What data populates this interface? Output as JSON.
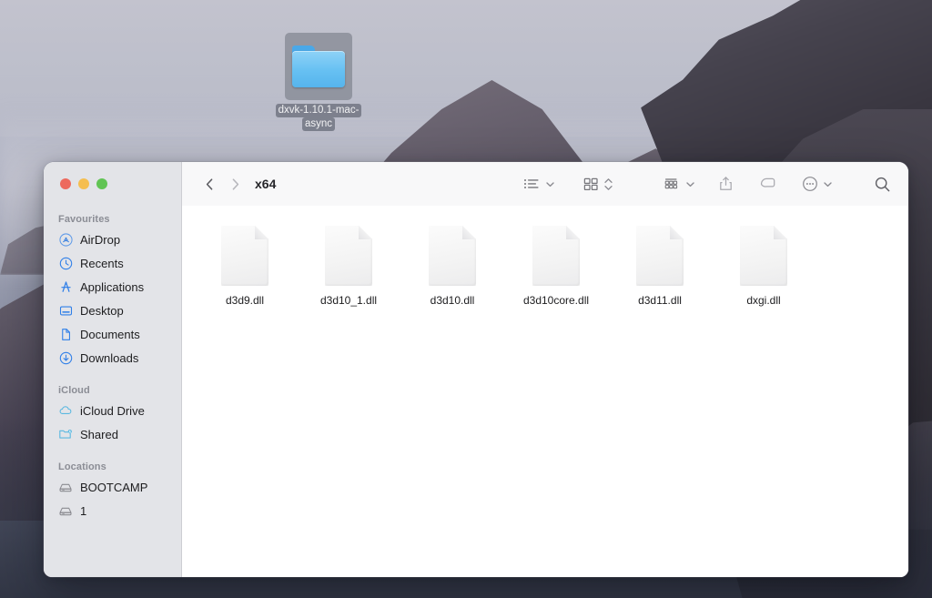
{
  "desktop": {
    "folder": {
      "icon": "blue-folder-icon",
      "name_line1": "dxvk-1.10.1-mac-",
      "name_line2": "async",
      "selected": true
    },
    "wallpaper_colors": {
      "sky": "#c3c3ce",
      "water": "#8a8fa3",
      "rock": "#46434e",
      "deep_water": "#4a5063"
    }
  },
  "finder": {
    "traffic_lights": {
      "close_label": "Close",
      "minimize_label": "Minimize",
      "zoom_label": "Zoom",
      "close_color": "#ed6a5e",
      "minimize_color": "#f5be4f",
      "zoom_color": "#61c454"
    },
    "toolbar": {
      "back_label": "Back",
      "forward_label": "Forward",
      "title": "x64",
      "view_list_label": "List view",
      "view_icon_label": "Icon view",
      "group_label": "Group items",
      "share_label": "Share",
      "tag_label": "Tags",
      "more_label": "More",
      "search_label": "Search"
    },
    "sidebar": {
      "sections": [
        {
          "header": "Favourites",
          "items": [
            {
              "label": "AirDrop",
              "icon": "airdrop-icon"
            },
            {
              "label": "Recents",
              "icon": "clock-icon"
            },
            {
              "label": "Applications",
              "icon": "applications-icon"
            },
            {
              "label": "Desktop",
              "icon": "desktop-icon"
            },
            {
              "label": "Documents",
              "icon": "document-icon"
            },
            {
              "label": "Downloads",
              "icon": "download-icon"
            }
          ]
        },
        {
          "header": "iCloud",
          "items": [
            {
              "label": "iCloud Drive",
              "icon": "cloud-icon"
            },
            {
              "label": "Shared",
              "icon": "shared-folder-icon"
            }
          ]
        },
        {
          "header": "Locations",
          "items": [
            {
              "label": "BOOTCAMP",
              "icon": "disk-icon"
            },
            {
              "label": "1",
              "icon": "disk-icon"
            }
          ]
        }
      ]
    },
    "files": [
      {
        "name": "d3d9.dll",
        "icon": "generic-document-icon"
      },
      {
        "name": "d3d10_1.dll",
        "icon": "generic-document-icon"
      },
      {
        "name": "d3d10.dll",
        "icon": "generic-document-icon"
      },
      {
        "name": "d3d10core.dll",
        "icon": "generic-document-icon"
      },
      {
        "name": "d3d11.dll",
        "icon": "generic-document-icon"
      },
      {
        "name": "dxgi.dll",
        "icon": "generic-document-icon"
      }
    ]
  }
}
